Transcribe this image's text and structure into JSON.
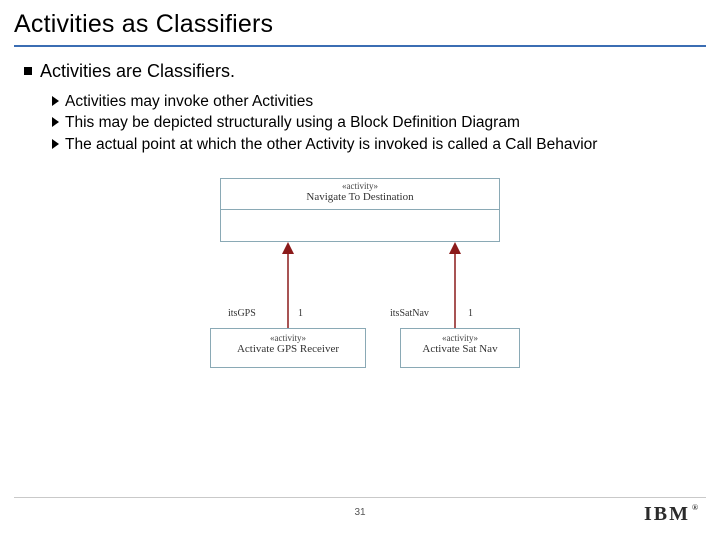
{
  "title": "Activities as Classifiers",
  "heading": "Activities are Classifiers.",
  "bullets": [
    "Activities may invoke other Activities",
    "This may be depicted structurally using a Block Definition   Diagram",
    "The actual point at which the other Activity is invoked is called a Call Behavior"
  ],
  "diagram": {
    "main": {
      "stereo": "«activity»",
      "name": "Navigate To Destination"
    },
    "left": {
      "stereo": "«activity»",
      "name": "Activate GPS Receiver",
      "role": "itsGPS",
      "mult": "1"
    },
    "right": {
      "stereo": "«activity»",
      "name": "Activate Sat Nav",
      "role": "itsSatNav",
      "mult": "1"
    }
  },
  "page_number": "31",
  "logo_text": "IBM",
  "logo_reg": "®"
}
